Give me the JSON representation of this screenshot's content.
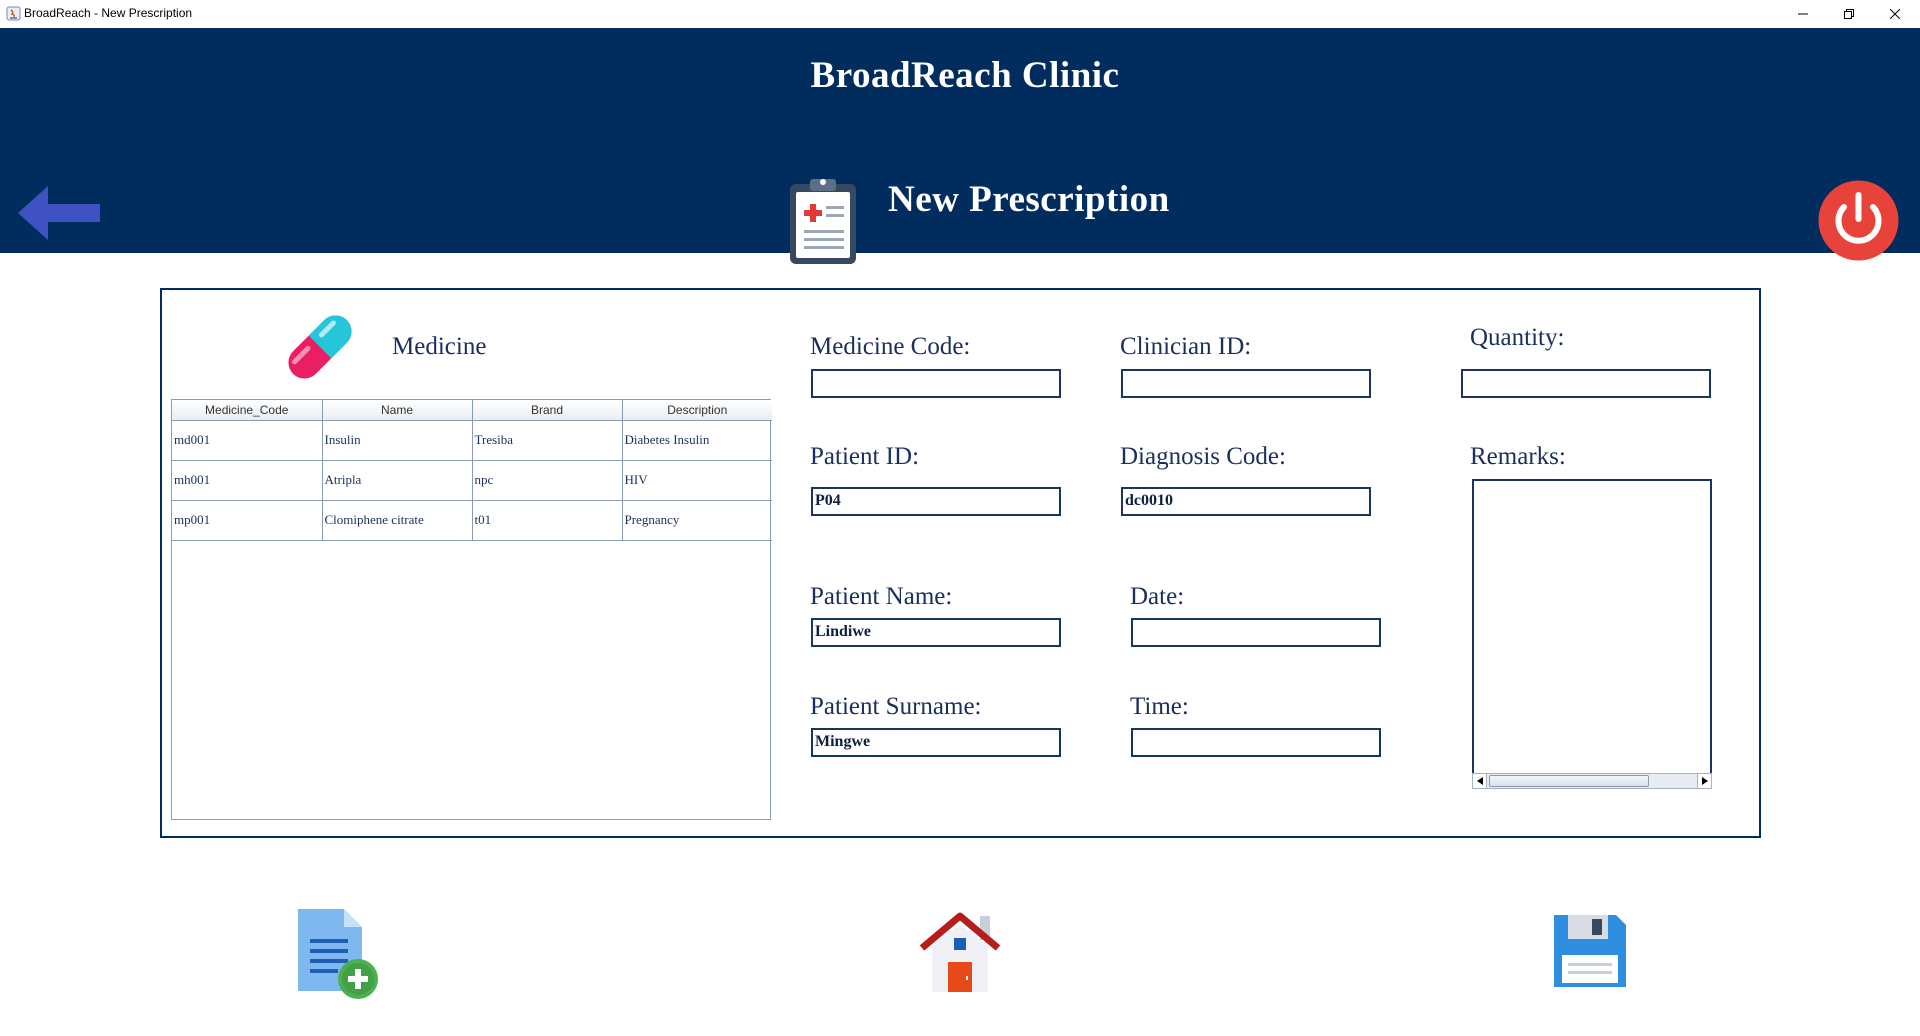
{
  "window": {
    "title": "BroadReach - New Prescription"
  },
  "header": {
    "clinic_name": "BroadReach Clinic",
    "page_title": "New Prescription"
  },
  "medicine": {
    "heading": "Medicine",
    "columns": [
      "Medicine_Code",
      "Name",
      "Brand",
      "Description"
    ],
    "rows": [
      [
        "md001",
        "Insulin",
        "Tresiba",
        "Diabetes Insulin"
      ],
      [
        "mh001",
        "Atripla",
        "npc",
        "HIV"
      ],
      [
        "mp001",
        "Clomiphene citrate",
        "t01",
        "Pregnancy"
      ]
    ]
  },
  "form": {
    "medicine_code": {
      "label": "Medicine Code:",
      "value": ""
    },
    "clinician_id": {
      "label": "Clinician ID:",
      "value": ""
    },
    "quantity": {
      "label": "Quantity:",
      "value": ""
    },
    "patient_id": {
      "label": "Patient ID:",
      "value": "P04"
    },
    "diagnosis_code": {
      "label": "Diagnosis Code:",
      "value": "dc0010"
    },
    "remarks": {
      "label": "Remarks:",
      "value": ""
    },
    "patient_name": {
      "label": "Patient Name:",
      "value": "Lindiwe"
    },
    "date": {
      "label": "Date:",
      "value": ""
    },
    "patient_surname": {
      "label": "Patient Surname:",
      "value": "Mingwe"
    },
    "time": {
      "label": "Time:",
      "value": ""
    }
  },
  "icons": {
    "back": "left-arrow-icon",
    "clipboard": "medical-clipboard-icon",
    "power": "power-icon",
    "medicine": "capsule-icon",
    "new": "add-document-icon",
    "home": "home-icon",
    "save": "floppy-disk-icon"
  },
  "colors": {
    "header_bg": "#002d5d",
    "accent_text": "#1a2f5c",
    "power_red": "#e8433a",
    "back_arrow": "#4052c2"
  }
}
